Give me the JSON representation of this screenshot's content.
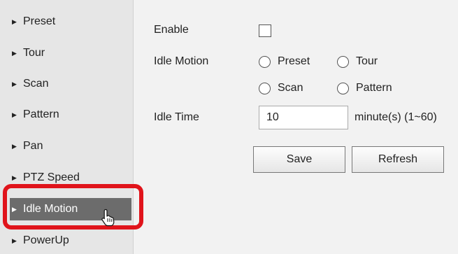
{
  "sidebar": {
    "items": [
      {
        "label": "Preset"
      },
      {
        "label": "Tour"
      },
      {
        "label": "Scan"
      },
      {
        "label": "Pattern"
      },
      {
        "label": "Pan"
      },
      {
        "label": "PTZ Speed"
      },
      {
        "label": "Idle Motion"
      },
      {
        "label": "PowerUp"
      }
    ]
  },
  "form": {
    "enable_label": "Enable",
    "enable_checked": false,
    "idle_motion_label": "Idle Motion",
    "idle_motion_options": [
      "Preset",
      "Tour",
      "Scan",
      "Pattern"
    ],
    "idle_time_label": "Idle Time",
    "idle_time_value": "10",
    "idle_time_unit": "minute(s) (1~60)"
  },
  "buttons": {
    "save": "Save",
    "refresh": "Refresh"
  },
  "colors": {
    "highlight": "#e0141b",
    "active_item": "#6c6c6c"
  }
}
